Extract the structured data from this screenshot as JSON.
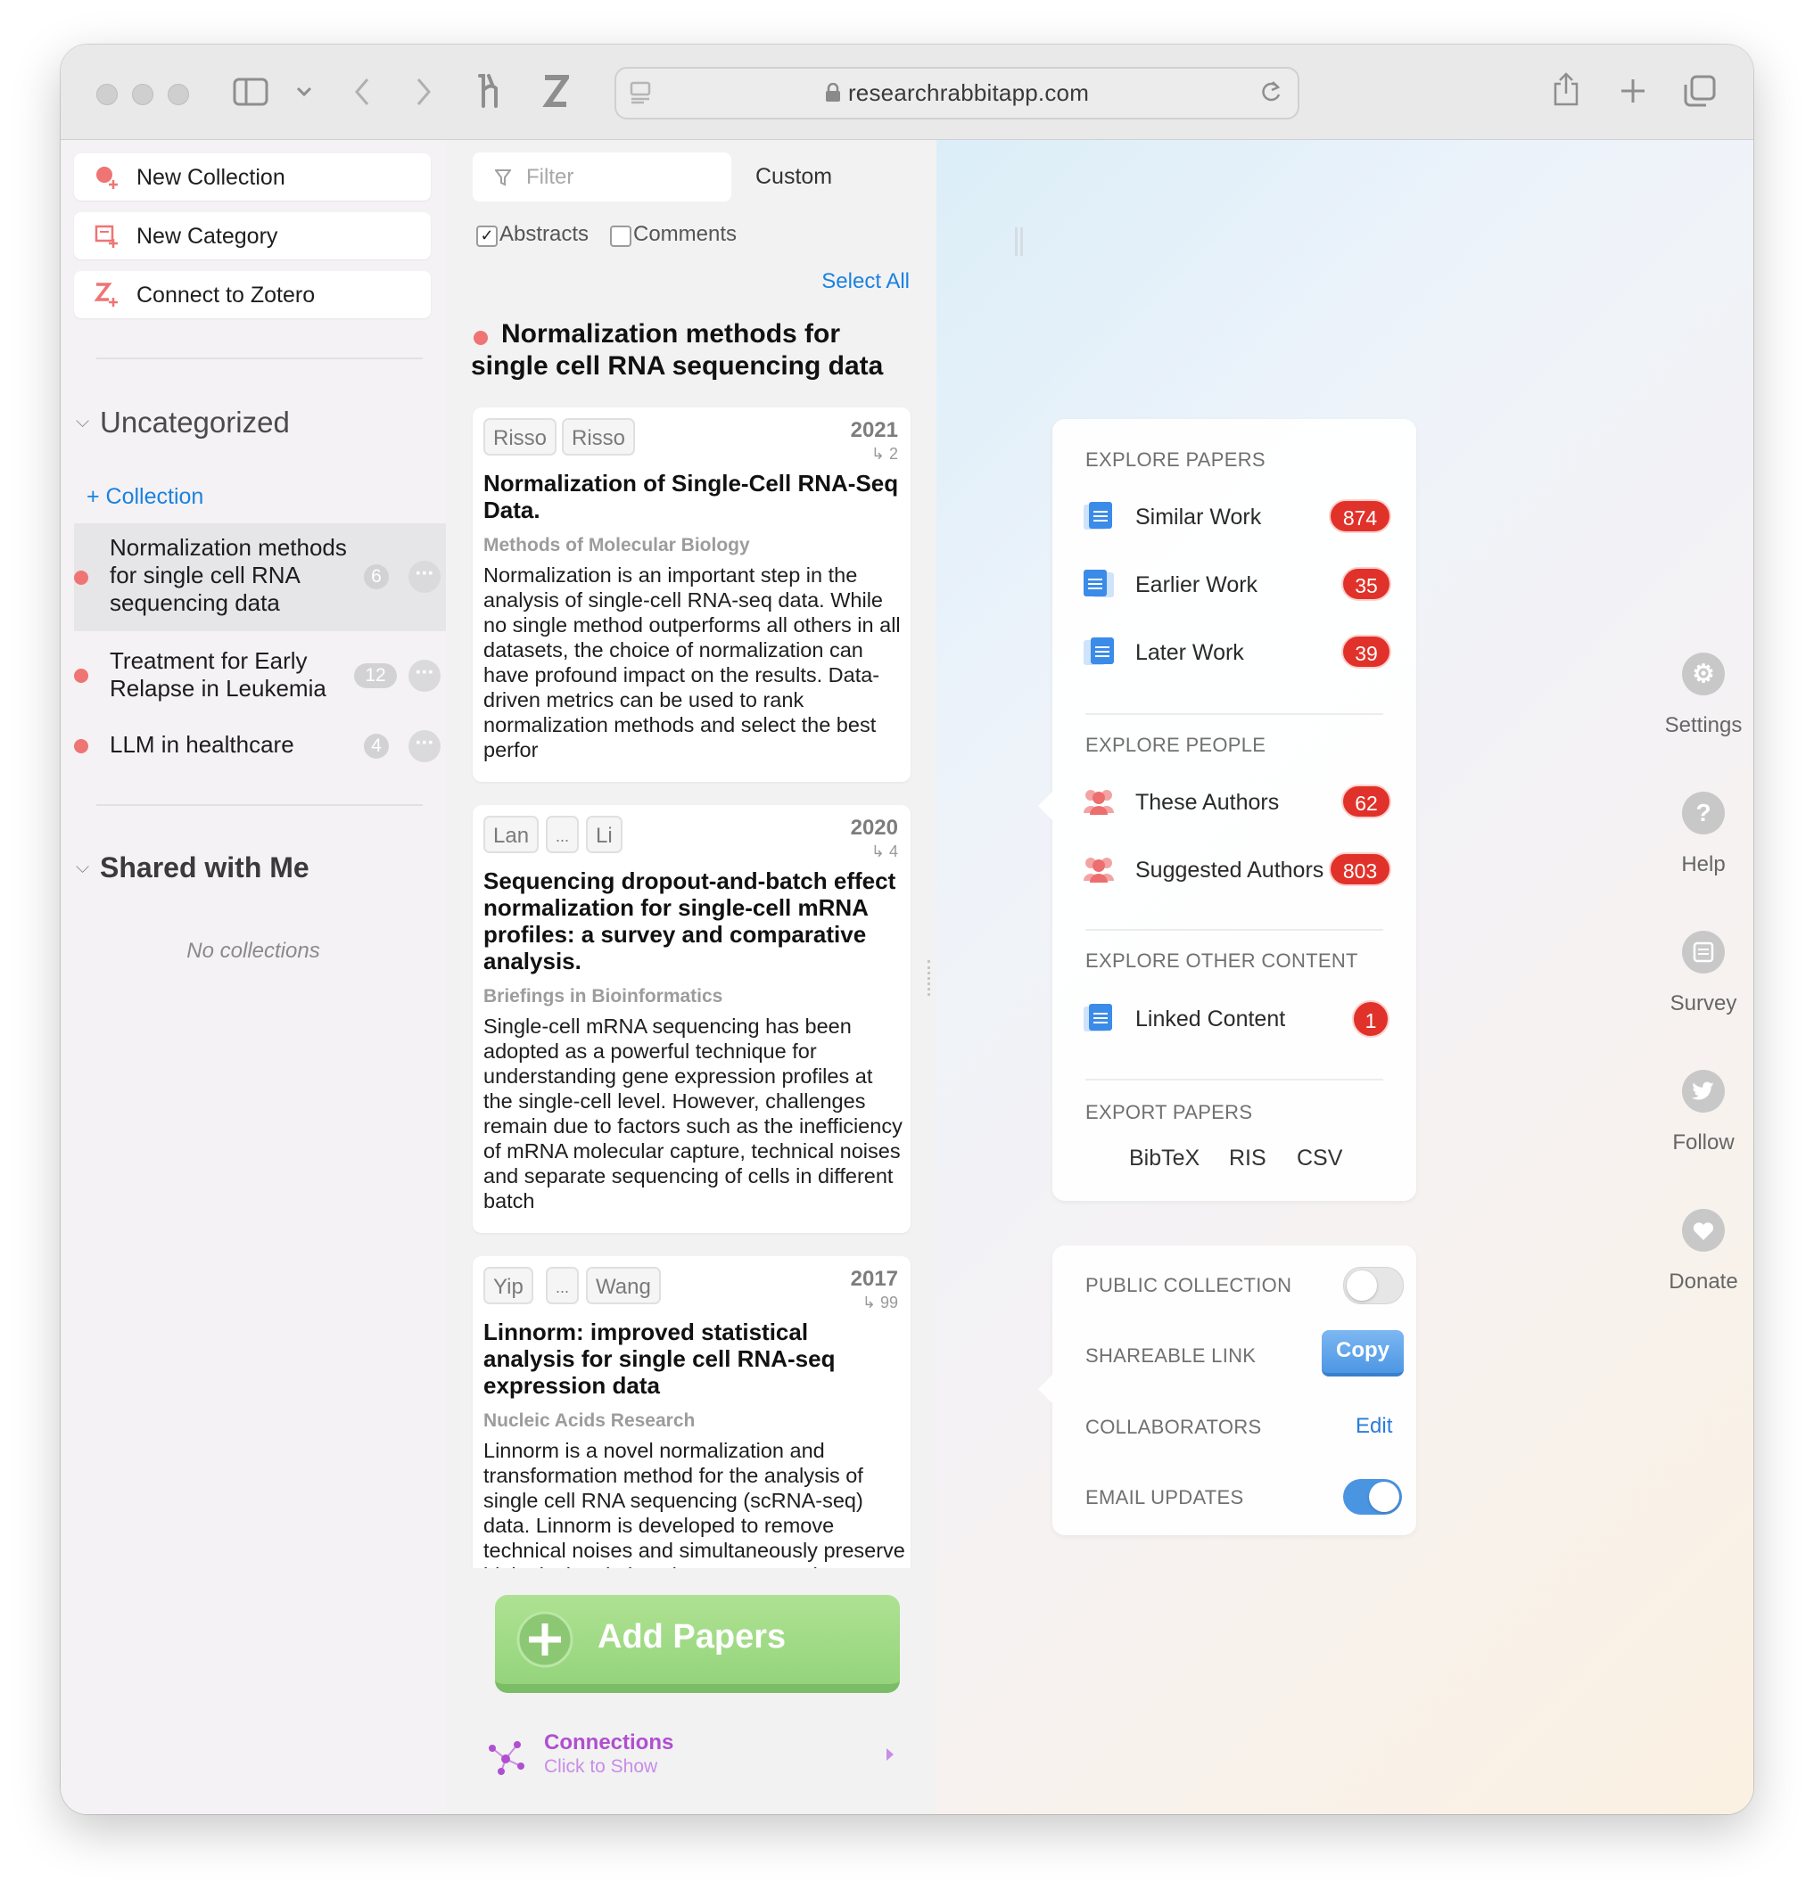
{
  "browser": {
    "url": "researchrabbitapp.com"
  },
  "left": {
    "buttons": [
      {
        "label": "New Collection",
        "icon": "new-collection-icon"
      },
      {
        "label": "New Category",
        "icon": "new-category-icon"
      },
      {
        "label": "Connect to Zotero",
        "icon": "zotero-icon"
      }
    ],
    "uncategorized_title": "Uncategorized",
    "add_collection": "+ Collection",
    "collections": [
      {
        "name": "Normalization methods for single cell RNA sequencing data",
        "lines": [
          "Normalization methods",
          "for single cell RNA",
          "sequencing data"
        ],
        "count": "6",
        "selected": true
      },
      {
        "name": "Treatment for Early Relapse in Leukemia",
        "lines": [
          "Treatment for Early",
          "Relapse in Leukemia"
        ],
        "count": "12",
        "selected": false
      },
      {
        "name": "LLM in healthcare",
        "lines": [
          "LLM in healthcare"
        ],
        "count": "4",
        "selected": false
      }
    ],
    "shared_title": "Shared with Me",
    "no_collections": "No collections"
  },
  "middle": {
    "filter_placeholder": "Filter",
    "sort_label": "Custom",
    "abstracts_label": "Abstracts",
    "abstracts_checked": true,
    "comments_label": "Comments",
    "comments_checked": false,
    "select_all": "Select All",
    "collection_title_lines": [
      "Normalization methods for",
      "single cell RNA sequencing data"
    ],
    "papers": [
      {
        "authors": [
          "Risso",
          "Risso"
        ],
        "year": "2021",
        "citations": "↳ 2",
        "title_lines": [
          "Normalization of Single-Cell RNA-Seq",
          "Data."
        ],
        "journal": "Methods of Molecular Biology",
        "abstract": "Normalization is an important step in the analysis of single-cell RNA-seq data. While no single method outperforms all others in all datasets, the choice of normalization can have profound impact on the results. Data-driven metrics can be used to rank normalization methods and select the best perfor"
      },
      {
        "authors": [
          "Lan",
          "...",
          "Li"
        ],
        "year": "2020",
        "citations": "↳ 4",
        "title_lines": [
          "Sequencing dropout-and-batch effect",
          "normalization for single-cell mRNA",
          "profiles: a survey and comparative",
          "analysis."
        ],
        "journal": "Briefings in Bioinformatics",
        "abstract": "Single-cell mRNA sequencing has been adopted as a powerful technique for understanding gene expression profiles at the single-cell level. However, challenges remain due to factors such as the inefficiency of mRNA molecular capture, technical noises and separate sequencing of cells in different batch"
      },
      {
        "authors": [
          "Yip",
          "...",
          "Wang"
        ],
        "year": "2017",
        "citations": "↳ 99",
        "title_lines": [
          "Linnorm: improved statistical",
          "analysis for single cell RNA-seq",
          "expression data"
        ],
        "journal": "Nucleic Acids Research",
        "abstract": "Linnorm is a novel normalization and transformation method for the analysis of single cell RNA sequencing (scRNA-seq) data. Linnorm is developed to remove technical noises and simultaneously preserve biological variations in scRNA-seq data"
      }
    ],
    "add_papers": "Add Papers",
    "connections_title": "Connections",
    "connections_sub": "Click to Show"
  },
  "explore": {
    "papers_heading": "EXPLORE PAPERS",
    "papers_items": [
      {
        "label": "Similar Work",
        "count": "874"
      },
      {
        "label": "Earlier Work",
        "count": "35"
      },
      {
        "label": "Later Work",
        "count": "39"
      }
    ],
    "people_heading": "EXPLORE PEOPLE",
    "people_items": [
      {
        "label": "These Authors",
        "count": "62"
      },
      {
        "label": "Suggested Authors",
        "count": "803"
      }
    ],
    "other_heading": "EXPLORE OTHER CONTENT",
    "other_items": [
      {
        "label": "Linked Content",
        "count": "1"
      }
    ],
    "export_heading": "EXPORT PAPERS",
    "export_formats": [
      "BibTeX",
      "RIS",
      "CSV"
    ]
  },
  "sharing": {
    "public_label": "PUBLIC COLLECTION",
    "public_on": false,
    "link_label": "SHAREABLE LINK",
    "copy_label": "Copy",
    "collab_label": "COLLABORATORS",
    "edit_label": "Edit",
    "email_label": "EMAIL UPDATES",
    "email_on": true
  },
  "side": [
    {
      "label": "Settings",
      "icon": "settings-icon"
    },
    {
      "label": "Help",
      "icon": "help-icon"
    },
    {
      "label": "Survey",
      "icon": "survey-icon"
    },
    {
      "label": "Follow",
      "icon": "twitter-icon"
    },
    {
      "label": "Donate",
      "icon": "heart-icon"
    }
  ],
  "colors": {
    "accent_blue": "#1a82e0",
    "collection_dot": "#ef7474",
    "badge_red": "#e0322a",
    "add_green": "#95d47c",
    "connections_purple": "#b04fd0"
  }
}
